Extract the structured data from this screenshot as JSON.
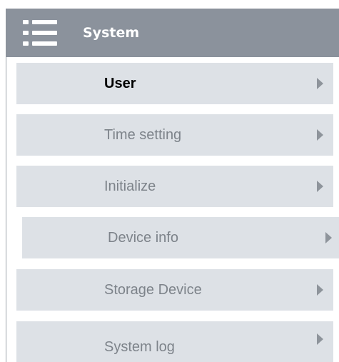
{
  "header": {
    "title": "System",
    "icon": "menu-list-icon",
    "background": "#8b929c"
  },
  "items": [
    {
      "label": "User",
      "active": true
    },
    {
      "label": "Time setting",
      "active": false
    },
    {
      "label": "Initialize",
      "active": false
    },
    {
      "label": "Device info",
      "active": false
    },
    {
      "label": "Storage Device",
      "active": false
    },
    {
      "label": "System log",
      "active": false
    }
  ],
  "colors": {
    "item_background": "#dde1e6",
    "label_active": "#000000",
    "label_inactive": "#7d838a",
    "arrow": "#8e949b"
  }
}
